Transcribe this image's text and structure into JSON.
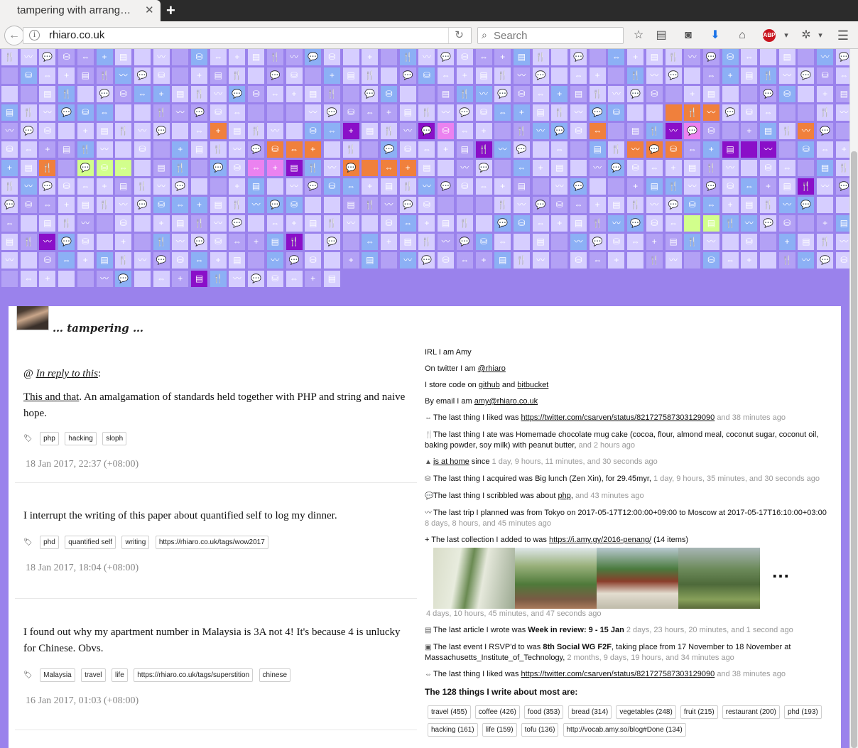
{
  "browser": {
    "tab_title": "tampering with arrang…",
    "url": "rhiaro.co.uk",
    "search_placeholder": "Search",
    "abp_label": "ABP"
  },
  "colors": {
    "page_bg": "#9a82ec",
    "tile_light": "#d6ceff",
    "tile_mid": "#b3a1f5",
    "tile_blue": "#8cb0f5",
    "tile_orange": "#f0803c",
    "tile_purple": "#8a0fc8",
    "tile_pink": "#eb82f0",
    "tile_green": "#d2ff8c"
  },
  "site": {
    "title": "… tampering …"
  },
  "posts": [
    {
      "reply_prefix": "@",
      "reply_link": "In reply to this",
      "reply_suffix": ":",
      "link_text": "This and that",
      "text": ". An amalgamation of standards held together with PHP and string and naive hope.",
      "tags": [
        "php",
        "hacking",
        "sloph"
      ],
      "date": "18 Jan 2017, 22:37 (+08:00)"
    },
    {
      "text": "I interrupt the writing of this paper about quantified self to log my dinner.",
      "tags": [
        "phd",
        "quantified self",
        "writing",
        "https://rhiaro.co.uk/tags/wow2017"
      ],
      "date": "18 Jan 2017, 18:04 (+08:00)"
    },
    {
      "text": "I found out why my apartment number in Malaysia is 3A not 4! It's because 4 is unlucky for Chinese. Obvs.",
      "tags": [
        "Malaysia",
        "travel",
        "life",
        "https://rhiaro.co.uk/tags/superstition",
        "chinese"
      ],
      "date": "16 Jan 2017, 01:03 (+08:00)"
    }
  ],
  "sidebar": {
    "irl": "IRL I am Amy",
    "twitter_prefix": "On twitter I am ",
    "twitter_handle": "@rhiaro",
    "code_prefix": "I store code on ",
    "github": "github",
    "and": " and ",
    "bitbucket": "bitbucket",
    "email_prefix": "By email I am ",
    "email": "amy@rhiaro.co.uk",
    "liked_prefix": "The last thing I liked was ",
    "liked_url": "https://twitter.com/csarven/status/821727587303129090",
    "liked_ago": "and 38 minutes ago",
    "ate_text": "The last thing I ate was Homemade chocolate mug cake (cocoa, flour, almond meal, coconut sugar, coconut oil, baking powder, soy milk) with peanut butter,",
    "ate_ago": "and 2 hours ago",
    "home_link": "is at home",
    "home_since": " since ",
    "home_ago": "1 day, 9 hours, 11 minutes, and 30 seconds ago",
    "acquired_text": "The last thing I acquired was Big lunch (Zen Xin), for 29.45myr,",
    "acquired_ago": "1 day, 9 hours, 35 minutes, and 30 seconds ago",
    "scribbled_prefix": "The last thing I scribbled was about ",
    "scribbled_link": "php",
    "scribbled_ago": "and 43 minutes ago",
    "trip_text": "The last trip I planned was from Tokyo on 2017-05-17T12:00:00+09:00 to Moscow at 2017-05-17T16:10:00+03:00",
    "trip_ago": "8 days, 8 hours, and 45 minutes ago",
    "collection_prefix": "+ The last collection I added to was ",
    "collection_url": "https://i.amy.gy/2016-penang/",
    "collection_count": " (14 items)",
    "photos_more": "…",
    "photos_ago": "4 days, 10 hours, 45 minutes, and 47 seconds ago",
    "article_prefix": "The last article I wrote was ",
    "article_title": "Week in review: 9 - 15 Jan",
    "article_ago": "2 days, 23 hours, 20 minutes, and 1 second ago",
    "event_prefix": "The last event I RSVP'd to was ",
    "event_title": "8th Social WG F2F",
    "event_text": ", taking place from 17 November to 18 November at Massachusetts_Institute_of_Technology,",
    "event_ago": "2 months, 9 days, 19 hours, and 34 minutes ago",
    "topics_title": "The 128 things I write about most are:",
    "topics": [
      "travel (455)",
      "coffee (426)",
      "food (353)",
      "bread (314)",
      "vegetables (248)",
      "fruit (215)",
      "restaurant (200)",
      "phd (193)",
      "hacking (161)",
      "life (159)",
      "tofu (136)",
      "http://vocab.amy.so/blog#Done (134)"
    ]
  }
}
